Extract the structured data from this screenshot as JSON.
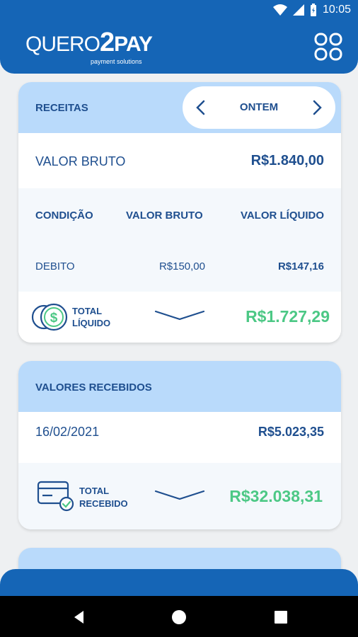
{
  "status_bar": {
    "time": "10:05"
  },
  "header": {
    "logo_part1": "QUERO",
    "logo_part2": "2",
    "logo_part3": "PAY",
    "logo_tagline": "payment solutions"
  },
  "receitas_card": {
    "title": "RECEITAS",
    "date_filter": "ONTEM",
    "valor_bruto_label": "VALOR BRUTO",
    "valor_bruto_value": "R$1.840,00",
    "table": {
      "headers": [
        "CONDIÇÃO",
        "VALOR BRUTO",
        "VALOR LÍQUIDO"
      ],
      "rows": [
        {
          "condicao": "DEBITO",
          "bruto": "R$150,00",
          "liquido": "R$147,16"
        }
      ]
    },
    "total_label_1": "TOTAL",
    "total_label_2": "LÍQUIDO",
    "total_value": "R$1.727,29"
  },
  "recebidos_card": {
    "title": "VALORES RECEBIDOS",
    "date": "16/02/2021",
    "amount": "R$5.023,35",
    "total_label_1": "TOTAL",
    "total_label_2": "RECEBIDO",
    "total_value": "R$32.038,31"
  },
  "colors": {
    "primary": "#1565b6",
    "accent_light": "#b9dafb",
    "text": "#1f4f8f",
    "positive": "#4cc885"
  }
}
